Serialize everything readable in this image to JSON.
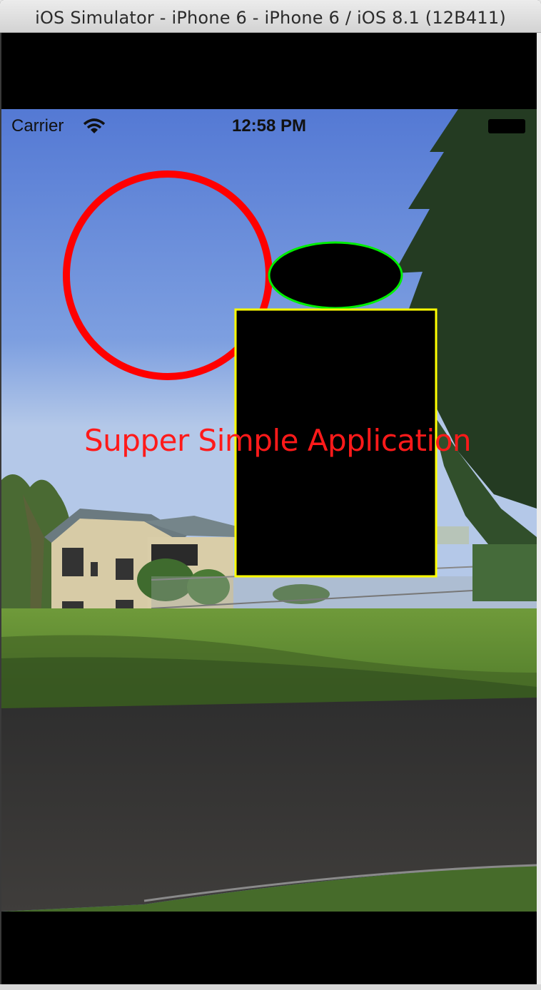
{
  "window": {
    "title": "iOS Simulator - iPhone 6 - iPhone 6 / iOS 8.1 (12B411)"
  },
  "status_bar": {
    "carrier": "Carrier",
    "time": "12:58 PM",
    "wifi_icon": "wifi-icon",
    "battery_icon": "battery-icon"
  },
  "app": {
    "title": "Supper Simple Application",
    "title_color": "#ff1a1a",
    "circle_stroke_color": "#ff0000",
    "ellipse_fill_color": "#000000",
    "ellipse_stroke_color": "#00ee00",
    "rectangle_fill_color": "#000000",
    "rectangle_stroke_color": "#ffff00"
  }
}
